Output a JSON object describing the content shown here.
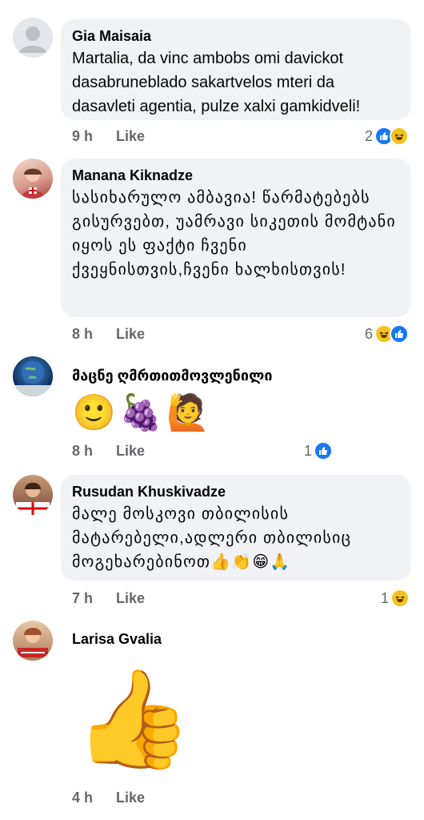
{
  "comments": [
    {
      "name": "Gia Maisaia",
      "text": "Martalia, da vinc ambobs omi davickot dasabruneblado sakartvelos mteri da dasavleti agentia, pulze xalxi gamkidveli!",
      "time": "9 h",
      "like": "Like",
      "reaction_count": "2",
      "reactions": [
        "like-icon",
        "haha-icon"
      ]
    },
    {
      "name": "Manana Kiknadze",
      "text": "სასიხარულო ამბავია! წარმატებებს გისურვებთ, უამრავი სიკეთის მომტანი იყოს ეს ფაქტი ჩვენი ქვეყნისთვის,ჩვენი ხალხისთვის!",
      "time": "8 h",
      "like": "Like",
      "reaction_count": "6",
      "reactions": [
        "haha-icon",
        "like-icon"
      ]
    },
    {
      "name": "მაცნე ღმრთითმოვლენილი",
      "emojis": [
        "🙂",
        "🍇",
        "🙋"
      ],
      "time": "8 h",
      "like": "Like",
      "reaction_count": "1",
      "reactions": [
        "like-icon"
      ]
    },
    {
      "name": "Rusudan Khuskivadze",
      "text": "მალე მოსკოვი თბილისის მატარებელი,ადლერი თბილისიც მოგეხარებინოთ👍👏😁🙏",
      "time": "7 h",
      "like": "Like",
      "reaction_count": "1",
      "reactions": [
        "haha-icon"
      ]
    },
    {
      "name": "Larisa Gvalia",
      "sticker": "👍",
      "time": "4 h",
      "like": "Like"
    }
  ]
}
